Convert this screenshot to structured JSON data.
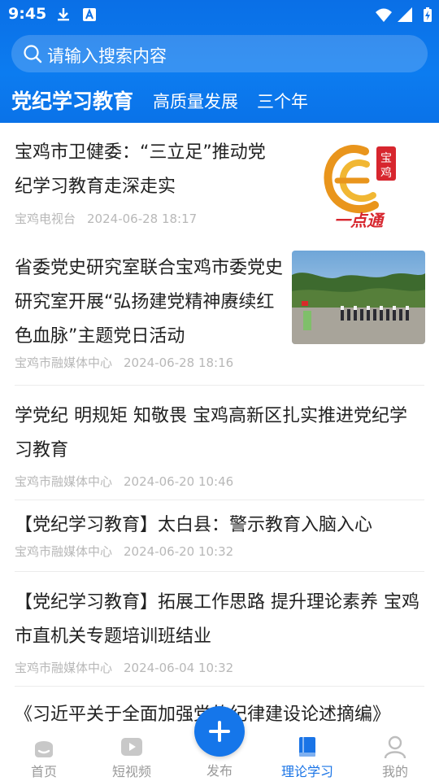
{
  "status_bar": {
    "time": "9:45"
  },
  "search": {
    "placeholder": "请输入搜索内容"
  },
  "tabs": [
    {
      "label": "党纪学习教育",
      "active": true
    },
    {
      "label": "高质量发展",
      "active": false
    },
    {
      "label": "三个年",
      "active": false
    }
  ],
  "articles": [
    {
      "title": "宝鸡市卫健委：“三立足”推动党纪学习教育走深走实",
      "source": "宝鸡电视台",
      "time": "2024-06-28 18:17",
      "thumb": "logo"
    },
    {
      "title": "省委党史研究室联合宝鸡市委党史研究室开展“弘扬建党精神赓续红色血脉”主题党日活动",
      "source": "宝鸡市融媒体中心",
      "time": "2024-06-28 18:16",
      "thumb": "photo"
    },
    {
      "title": "学党纪 明规矩 知敬畏 宝鸡高新区扎实推进党纪学习教育",
      "source": "宝鸡市融媒体中心",
      "time": "2024-06-20 10:46"
    },
    {
      "title": "【党纪学习教育】太白县：警示教育入脑入心",
      "source": "宝鸡市融媒体中心",
      "time": "2024-06-20 10:32"
    },
    {
      "title": "【党纪学习教育】拓展工作思路 提升理论素养 宝鸡市直机关专题培训班结业",
      "source": "宝鸡市融媒体中心",
      "time": "2024-06-04 10:32"
    },
    {
      "title": "《习近平关于全面加强党的纪律建设论述摘编》"
    }
  ],
  "thumb_logo": {
    "line1": "宝",
    "line2": "鸡",
    "bottom": "一点通"
  },
  "bottom_nav": [
    {
      "label": "首页",
      "icon": "home-icon",
      "active": false
    },
    {
      "label": "短视频",
      "icon": "video-icon",
      "active": false
    },
    {
      "label": "发布",
      "icon": "plus-icon",
      "active": false
    },
    {
      "label": "理论学习",
      "icon": "book-icon",
      "active": true
    },
    {
      "label": "我的",
      "icon": "user-icon",
      "active": false
    }
  ],
  "colors": {
    "primary": "#0c7cf0",
    "nav_active": "#1a74e6",
    "meta_text": "#b8b8b8"
  }
}
